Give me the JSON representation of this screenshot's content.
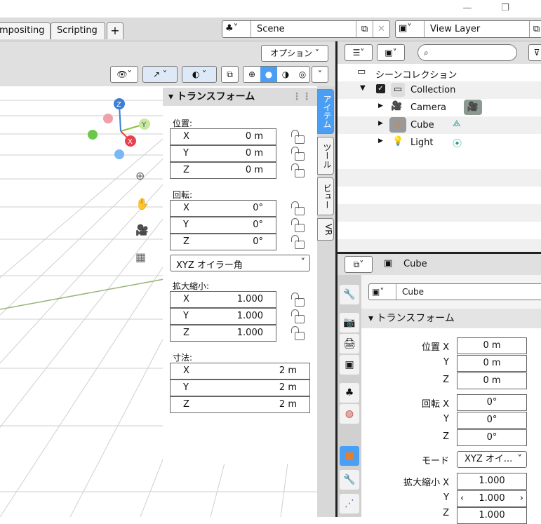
{
  "window": {
    "minimize_glyph": "—",
    "maximize_glyph": "❐"
  },
  "workspace_tabs": [
    {
      "label": "mpositing"
    },
    {
      "label": "Scripting"
    },
    {
      "label": "+"
    }
  ],
  "scene": {
    "name": "Scene"
  },
  "view_layer": {
    "name": "View Layer"
  },
  "viewport": {
    "options_label": "オプション"
  },
  "transform_panel": {
    "title": "トランスフォーム",
    "location": {
      "label": "位置:",
      "x": "0 m",
      "y": "0 m",
      "z": "0 m"
    },
    "rotation": {
      "label": "回転:",
      "x": "0°",
      "y": "0°",
      "z": "0°"
    },
    "rotation_mode": "XYZ オイラー角",
    "scale": {
      "label": "拡大縮小:",
      "x": "1.000",
      "y": "1.000",
      "z": "1.000"
    },
    "dimensions": {
      "label": "寸法:",
      "x": "2 m",
      "y": "2 m",
      "z": "2 m"
    },
    "axis_labels": {
      "x": "X",
      "y": "Y",
      "z": "Z"
    }
  },
  "side_tabs": [
    {
      "label": "アイテム"
    },
    {
      "label": "ツール"
    },
    {
      "label": "ビュー"
    },
    {
      "label": "VR"
    }
  ],
  "outliner": {
    "scene_collection": "シーンコレクション",
    "collection": "Collection",
    "items": [
      {
        "name": "Camera"
      },
      {
        "name": "Cube"
      },
      {
        "name": "Light"
      }
    ]
  },
  "properties": {
    "object_name": "Cube",
    "data_name": "Cube",
    "panel_title": "トランスフォーム",
    "location": {
      "label": "位置 X",
      "x": "0 m",
      "y": "0 m",
      "z": "0 m"
    },
    "rotation": {
      "label": "回転 X",
      "x": "0°",
      "y": "0°",
      "z": "0°"
    },
    "mode": {
      "label": "モード",
      "value": "XYZ オイ..."
    },
    "scale": {
      "label": "拡大縮小 X",
      "x": "1.000",
      "y": "1.000",
      "z": "1.000"
    },
    "axis_y": "Y",
    "axis_z": "Z"
  },
  "colors": {
    "accent": "#4a9ff5",
    "x_axis": "#e8414f",
    "y_axis": "#8ac23a",
    "z_axis": "#3a7ed8",
    "active_orange": "#e87d2b"
  }
}
